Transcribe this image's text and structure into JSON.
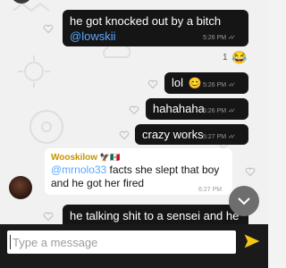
{
  "messages": [
    {
      "text": "he got knocked out by a bitch",
      "mention": "@lowskii",
      "time": "5:26 PM"
    },
    {
      "reaction_count": "1",
      "reaction_emoji": "😂"
    },
    {
      "text": "lol",
      "emoji": "😊",
      "time": "5:26 PM"
    },
    {
      "text": "hahahaha",
      "time": "5:26 PM"
    },
    {
      "text": "crazy works",
      "time": "5:27 PM"
    },
    {
      "sender": "Wooskilow",
      "sender_emoji": "🦅🇲🇽",
      "mention": "@mrnolo33",
      "text": " facts she slept that boy and he got her fired",
      "time": "6:27 PM"
    },
    {
      "text": "he talking shit to a sensei and he"
    }
  ],
  "read_ticks": "✓✓",
  "composer": {
    "placeholder": "Type a message"
  },
  "colors": {
    "bubble": "#151515",
    "mention": "#5aa9ff",
    "sender": "#c79400",
    "send": "#f5c518"
  }
}
